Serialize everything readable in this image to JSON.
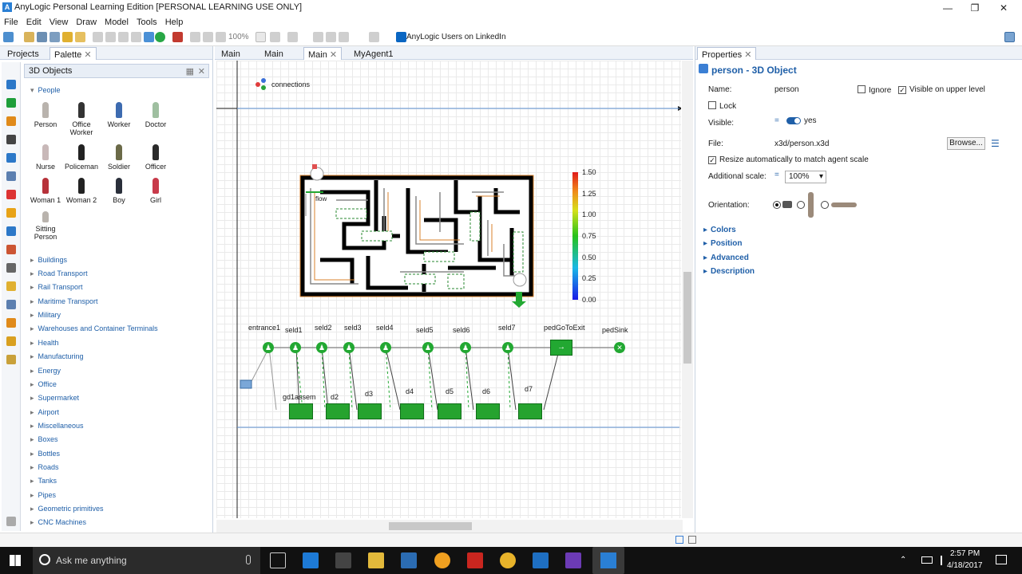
{
  "window": {
    "title": "AnyLogic Personal Learning Edition [PERSONAL LEARNING USE ONLY]"
  },
  "menu": [
    "File",
    "Edit",
    "View",
    "Draw",
    "Model",
    "Tools",
    "Help"
  ],
  "toolbar": {
    "zoom": "100%",
    "linkedin": "AnyLogic Users on LinkedIn"
  },
  "left": {
    "tabs": [
      "Projects",
      "Palette"
    ],
    "palette_title": "3D Objects",
    "people_header": "People",
    "people": [
      "Person",
      "Office Worker",
      "Worker",
      "Doctor",
      "Nurse",
      "Policeman",
      "Soldier",
      "Officer",
      "Woman 1",
      "Woman 2",
      "Boy",
      "Girl",
      "Sitting Person"
    ],
    "categories": [
      "Buildings",
      "Road Transport",
      "Rail Transport",
      "Maritime Transport",
      "Military",
      "Warehouses and Container Terminals",
      "Health",
      "Manufacturing",
      "Energy",
      "Office",
      "Supermarket",
      "Airport",
      "Miscellaneous",
      "Boxes",
      "Bottles",
      "Roads",
      "Tanks",
      "Pipes",
      "Geometric primitives",
      "CNC Machines"
    ]
  },
  "editor": {
    "tabs": [
      "Main",
      "Main",
      "Main",
      "MyAgent1"
    ],
    "connections_label": "connections",
    "legend_values": [
      "1.50",
      "1.25",
      "1.00",
      "0.75",
      "0.50",
      "0.25",
      "0.00"
    ],
    "flow_labels": {
      "entrance": "entrance1",
      "selects": [
        "seld1",
        "seld2",
        "seld3",
        "seld4",
        "seld5",
        "seld6",
        "seld7"
      ],
      "goto": "pedGoToExit",
      "sink": "pedSink",
      "delays": [
        "gd1assem",
        "d2",
        "d3",
        "d4",
        "d5",
        "d6",
        "d7"
      ]
    },
    "map_label": "flow"
  },
  "properties": {
    "tab": "Properties",
    "title": "person - 3D Object",
    "name_label": "Name:",
    "name_value": "person",
    "ignore_label": "Ignore",
    "visible_upper_label": "Visible on upper level",
    "lock_label": "Lock",
    "visible_label": "Visible:",
    "visible_value": "yes",
    "file_label": "File:",
    "file_value": "x3d/person.x3d",
    "browse_label": "Browse...",
    "resize_label": "Resize automatically to match agent scale",
    "scale_label": "Additional scale:",
    "scale_value": "100%",
    "orientation_label": "Orientation:",
    "sections": [
      "Colors",
      "Position",
      "Advanced",
      "Description"
    ]
  },
  "taskbar": {
    "search_placeholder": "Ask me anything",
    "time": "2:57 PM",
    "date": "4/18/2017"
  },
  "colors": {
    "accent": "#1f5fa8",
    "green": "#22a832",
    "maze_wall": "#000000",
    "maze_border": "#d9822b"
  }
}
